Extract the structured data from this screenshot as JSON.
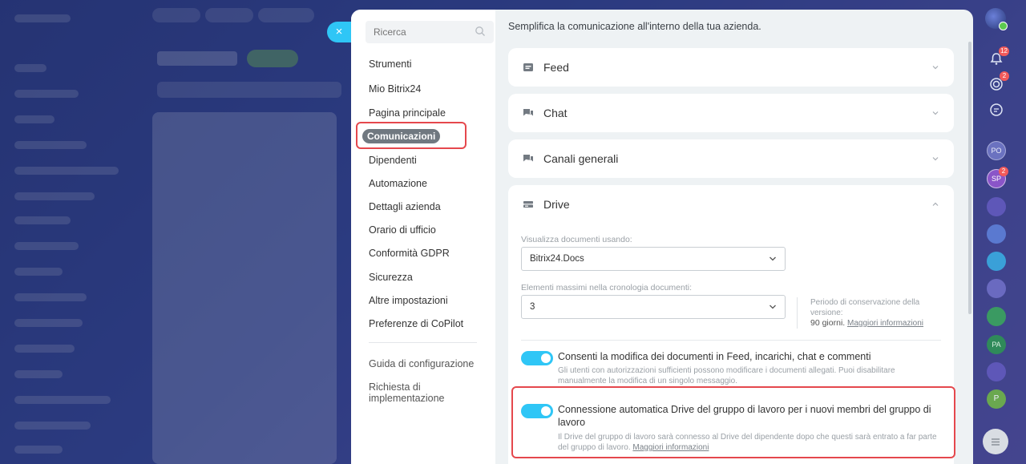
{
  "close_label": "×",
  "search": {
    "placeholder": "Ricerca"
  },
  "nav": {
    "items": [
      {
        "label": "Strumenti"
      },
      {
        "label": "Mio Bitrix24"
      },
      {
        "label": "Pagina principale"
      },
      {
        "label": "Comunicazioni",
        "active": true
      },
      {
        "label": "Dipendenti"
      },
      {
        "label": "Automazione"
      },
      {
        "label": "Dettagli azienda"
      },
      {
        "label": "Orario di ufficio"
      },
      {
        "label": "Conformità GDPR"
      },
      {
        "label": "Sicurezza"
      },
      {
        "label": "Altre impostazioni"
      },
      {
        "label": "Preferenze di CoPilot"
      }
    ],
    "footer": [
      {
        "label": "Guida di configurazione"
      },
      {
        "label": "Richiesta di implementazione"
      }
    ]
  },
  "intro": "Semplifica la comunicazione all'interno della tua azienda.",
  "sections": [
    {
      "title": "Feed",
      "icon": "feed-icon"
    },
    {
      "title": "Chat",
      "icon": "chat-icon"
    },
    {
      "title": "Canali generali",
      "icon": "channels-icon"
    },
    {
      "title": "Drive",
      "icon": "drive-icon"
    }
  ],
  "drive": {
    "view_label": "Visualizza documenti usando:",
    "view_value": "Bitrix24.Docs",
    "max_label": "Elementi massimi nella cronologia documenti:",
    "max_value": "3",
    "retention_label": "Periodo di conservazione della versione:",
    "retention_days": "90 giorni.",
    "retention_link": "Maggiori informazioni",
    "opt1_title": "Consenti la modifica dei documenti in Feed, incarichi, chat e commenti",
    "opt1_desc": "Gli utenti con autorizzazioni sufficienti possono modificare i documenti allegati. Puoi disabilitare manualmente la modifica di un singolo messaggio.",
    "opt2_title": "Connessione automatica Drive del gruppo di lavoro per i nuovi membri del gruppo di lavoro",
    "opt2_desc": "Il Drive del gruppo di lavoro sarà connesso al Drive del dipendente dopo che questi sarà entrato a far parte del gruppo di lavoro.",
    "opt2_link": "Maggiori informazioni"
  },
  "right_bar": {
    "notifications_badge": "12",
    "activity_badge": "2",
    "sp_badge": "2",
    "avatars": [
      "PO",
      "SP",
      "PA",
      "P"
    ]
  },
  "colors": {
    "accent": "#2fc6f6",
    "highlight": "#e5484d",
    "active_nav": "#707880"
  }
}
